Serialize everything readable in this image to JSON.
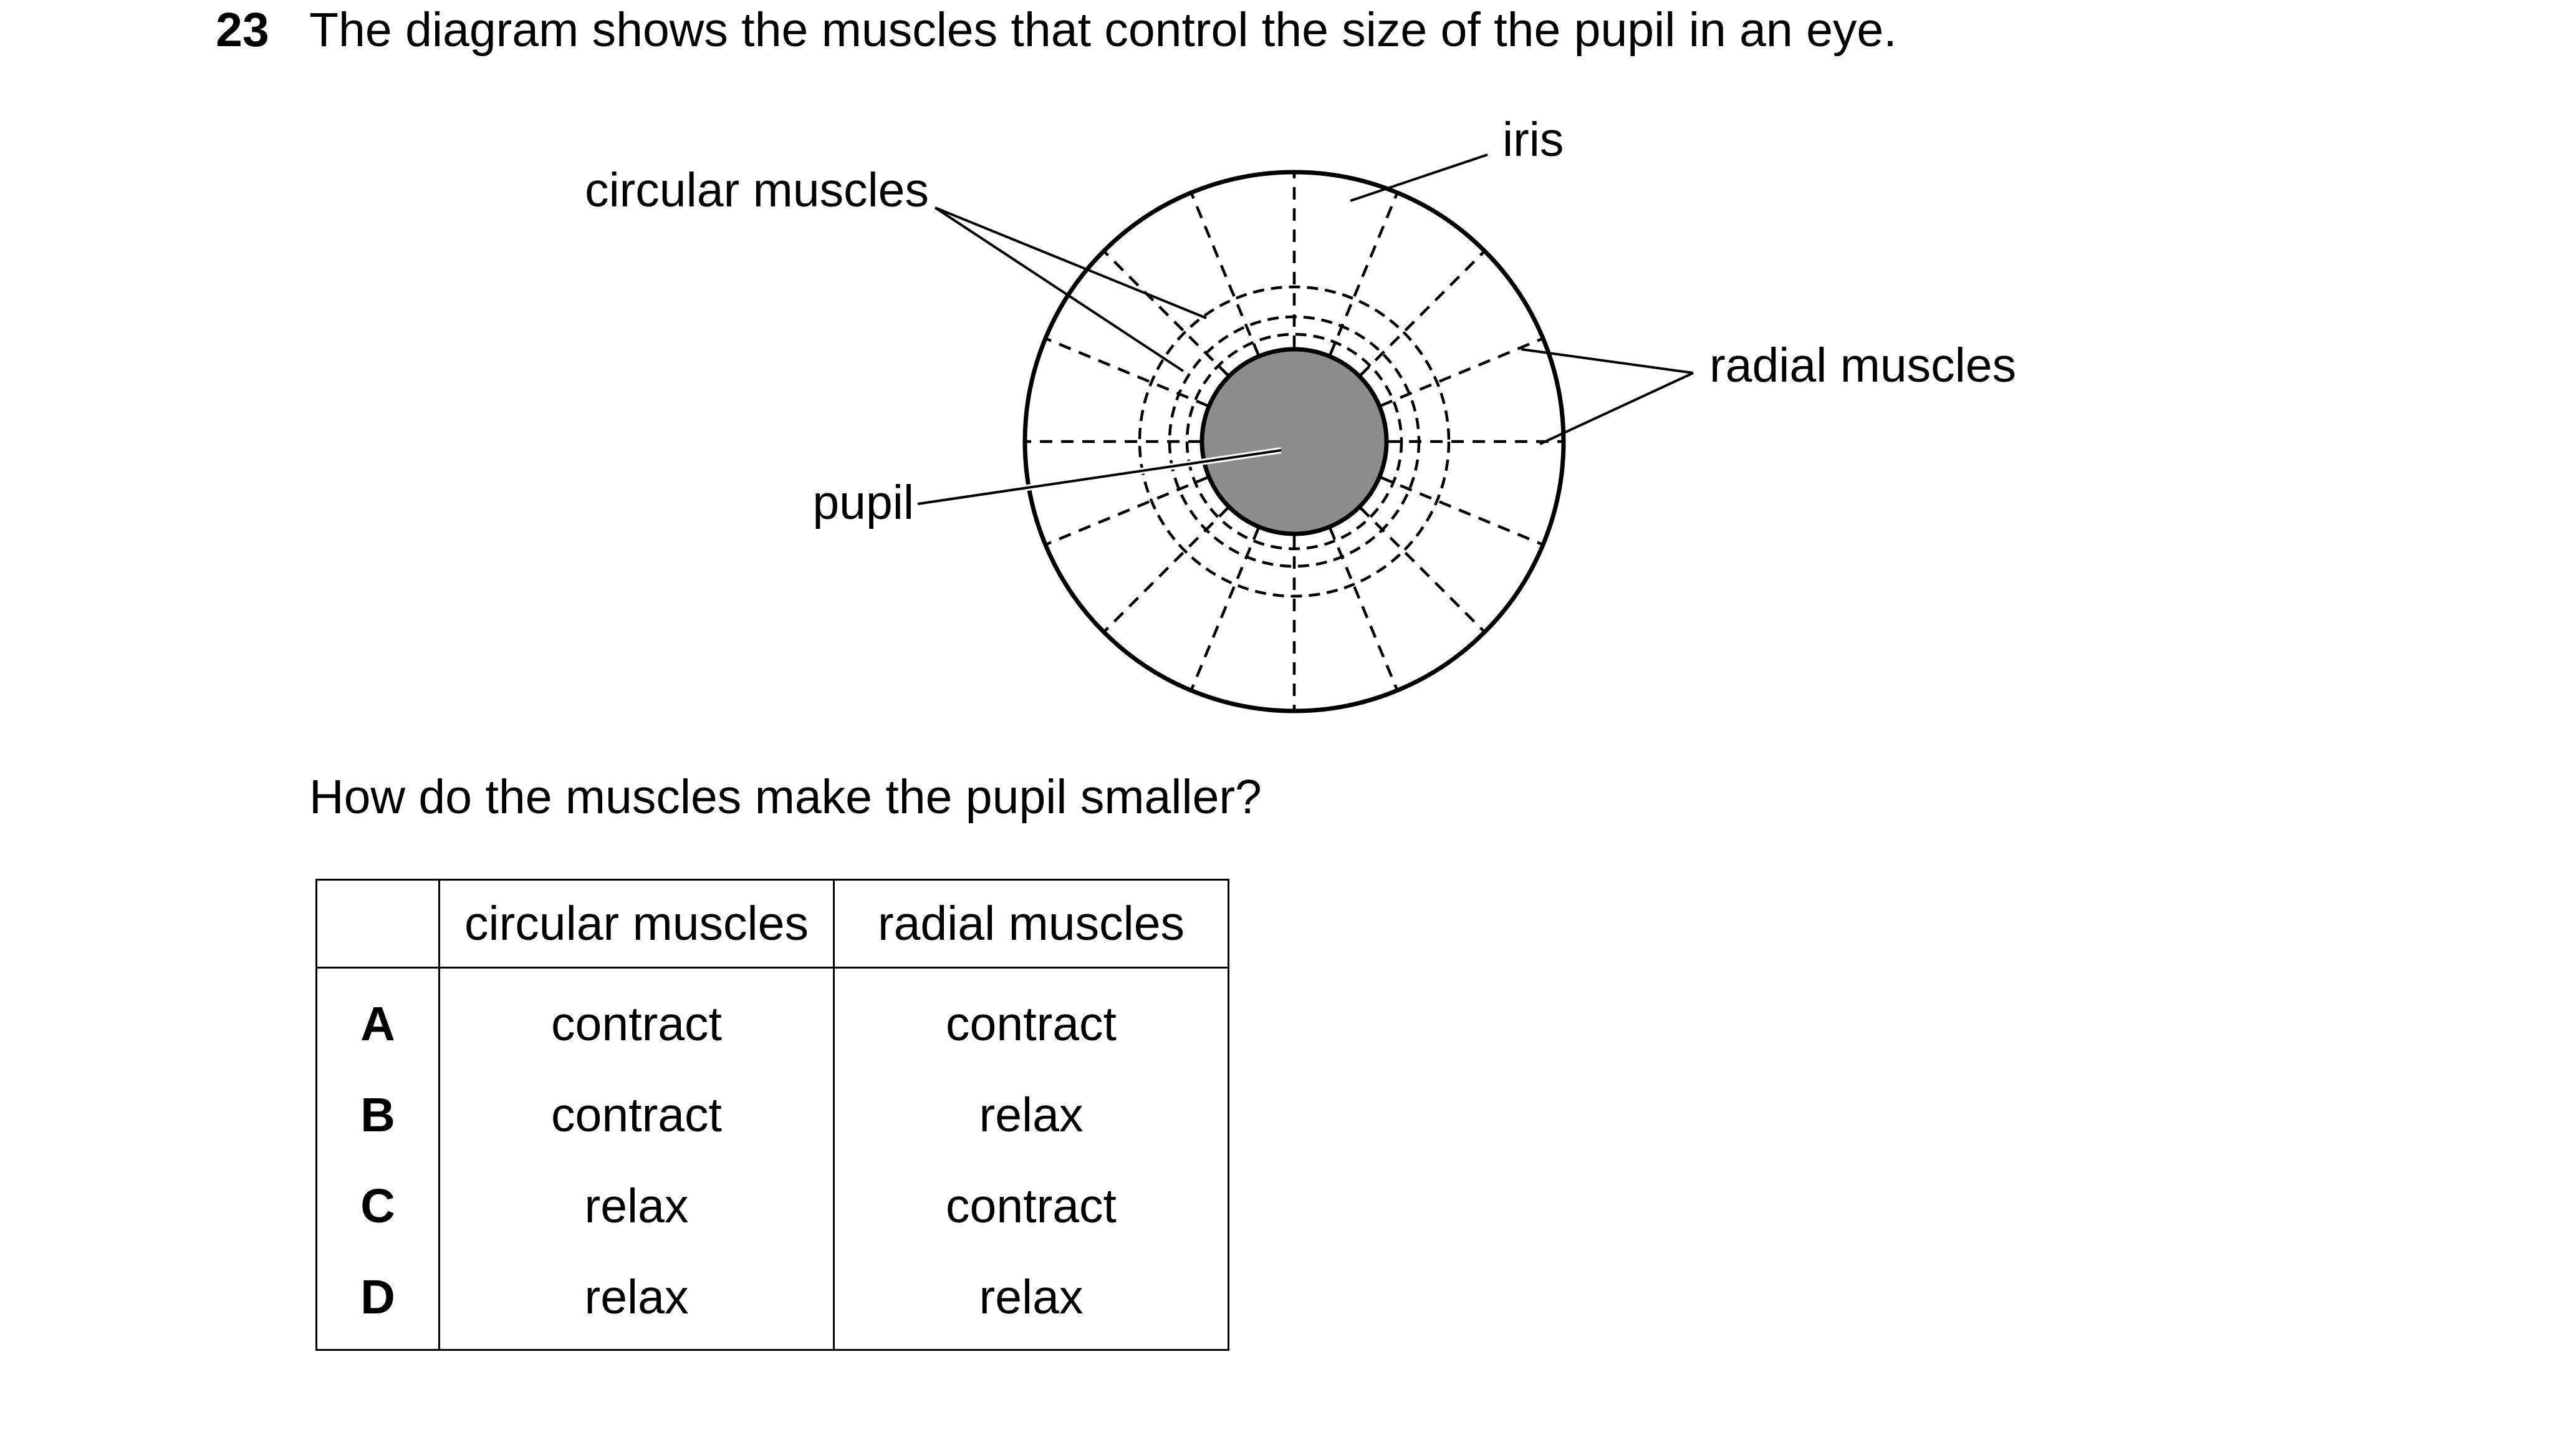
{
  "question": {
    "number": "23",
    "stem": "The diagram shows the muscles that control the size of the pupil in an eye.",
    "prompt": "How do the muscles make the pupil smaller?"
  },
  "diagram": {
    "labels": {
      "iris": "iris",
      "circular": "circular muscles",
      "radial": "radial muscles",
      "pupil": "pupil"
    },
    "pupil_color": "#8c8c8c"
  },
  "table": {
    "headers": [
      "",
      "circular muscles",
      "radial muscles"
    ],
    "rows": [
      {
        "option": "A",
        "circular": "contract",
        "radial": "contract"
      },
      {
        "option": "B",
        "circular": "contract",
        "radial": "relax"
      },
      {
        "option": "C",
        "circular": "relax",
        "radial": "contract"
      },
      {
        "option": "D",
        "circular": "relax",
        "radial": "relax"
      }
    ]
  }
}
